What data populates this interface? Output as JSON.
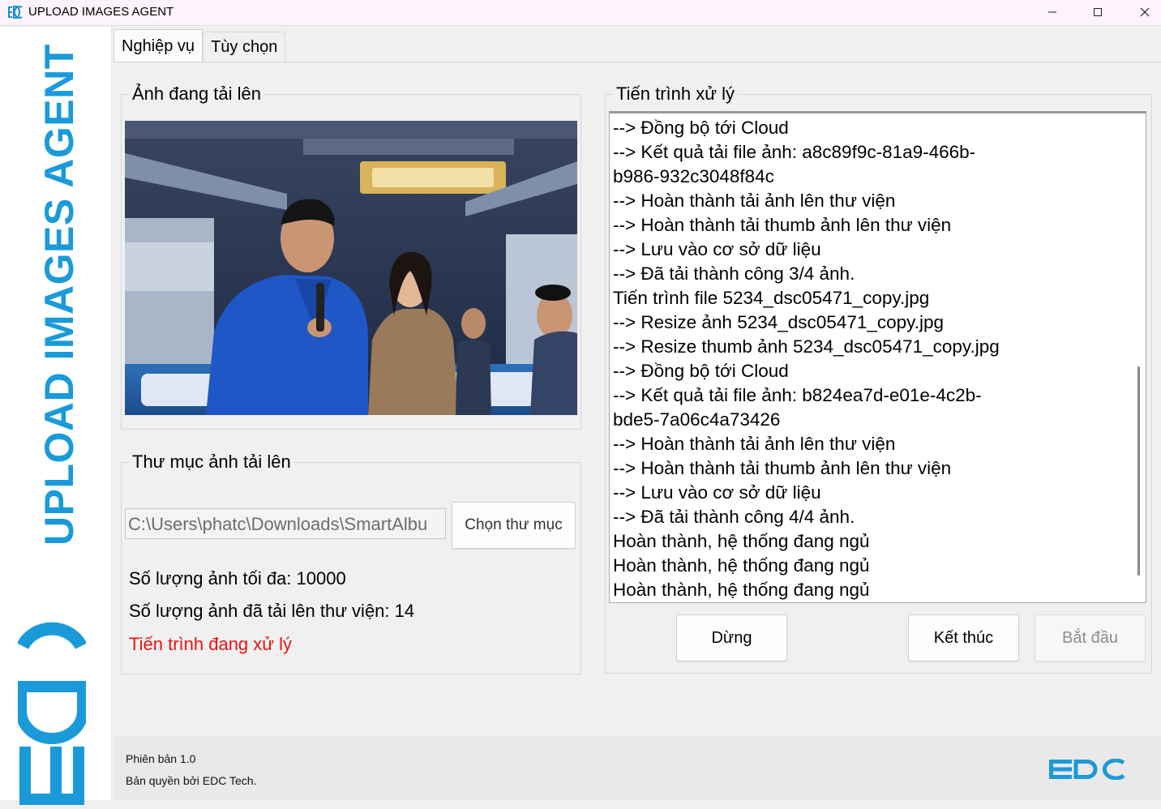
{
  "window": {
    "title": "UPLOAD IMAGES AGENT",
    "icon": "edc-logo-icon",
    "controls": [
      "minimize-icon",
      "maximize-icon",
      "close-icon"
    ]
  },
  "brand": {
    "vertical_title": "UPLOAD IMAGES AGENT",
    "logo_text": "EDC",
    "color": "#1a9ad9"
  },
  "tabs": [
    {
      "label": "Nghiệp vụ",
      "active": true
    },
    {
      "label": "Tùy chọn",
      "active": false
    }
  ],
  "uploading_image": {
    "legend": "Ảnh đang tải lên"
  },
  "folder": {
    "legend": "Thư mục ảnh tải lên",
    "path_value": "C:\\Users\\phatc\\Downloads\\SmartAlbu",
    "choose_button": "Chọn thư mục",
    "max_images": "Số lượng ảnh tối đa: 10000",
    "uploaded_count": "Số lượng ảnh đã tải lên thư viện:  14",
    "status": "Tiến trình đang xử lý",
    "status_color": "#ee1111"
  },
  "process": {
    "legend": "Tiến trình xử lý",
    "log_lines": [
      "--> Đồng bộ tới Cloud",
      "--> Kết quả tải file ảnh: a8c89f9c-81a9-466b-",
      "b986-932c3048f84c",
      "--> Hoàn thành tải ảnh lên thư viện",
      "--> Hoàn thành tải thumb ảnh lên thư viện",
      "--> Lưu vào cơ sở dữ liệu",
      "--> Đã tải thành công 3/4 ảnh.",
      "Tiến trình file 5234_dsc05471_copy.jpg",
      "--> Resize ảnh 5234_dsc05471_copy.jpg",
      "--> Resize thumb ảnh 5234_dsc05471_copy.jpg",
      "--> Đồng bộ tới Cloud",
      "--> Kết quả tải file ảnh: b824ea7d-e01e-4c2b-",
      "bde5-7a06c4a73426",
      "--> Hoàn thành tải ảnh lên thư viện",
      "--> Hoàn thành tải thumb ảnh lên thư viện",
      "--> Lưu vào cơ sở dữ liệu",
      "--> Đã tải thành công 4/4 ảnh.",
      "Hoàn thành, hệ thống đang ngủ",
      "Hoàn thành, hệ thống đang ngủ",
      "Hoàn thành, hệ thống đang ngủ"
    ],
    "stop_button": "Dừng",
    "finish_button": "Kết thúc",
    "start_button": "Bắt đầu"
  },
  "footer": {
    "version": "Phiên bản 1.0",
    "copyright": "Bản quyền bởi EDC Tech.",
    "logo_text": "EDC"
  }
}
